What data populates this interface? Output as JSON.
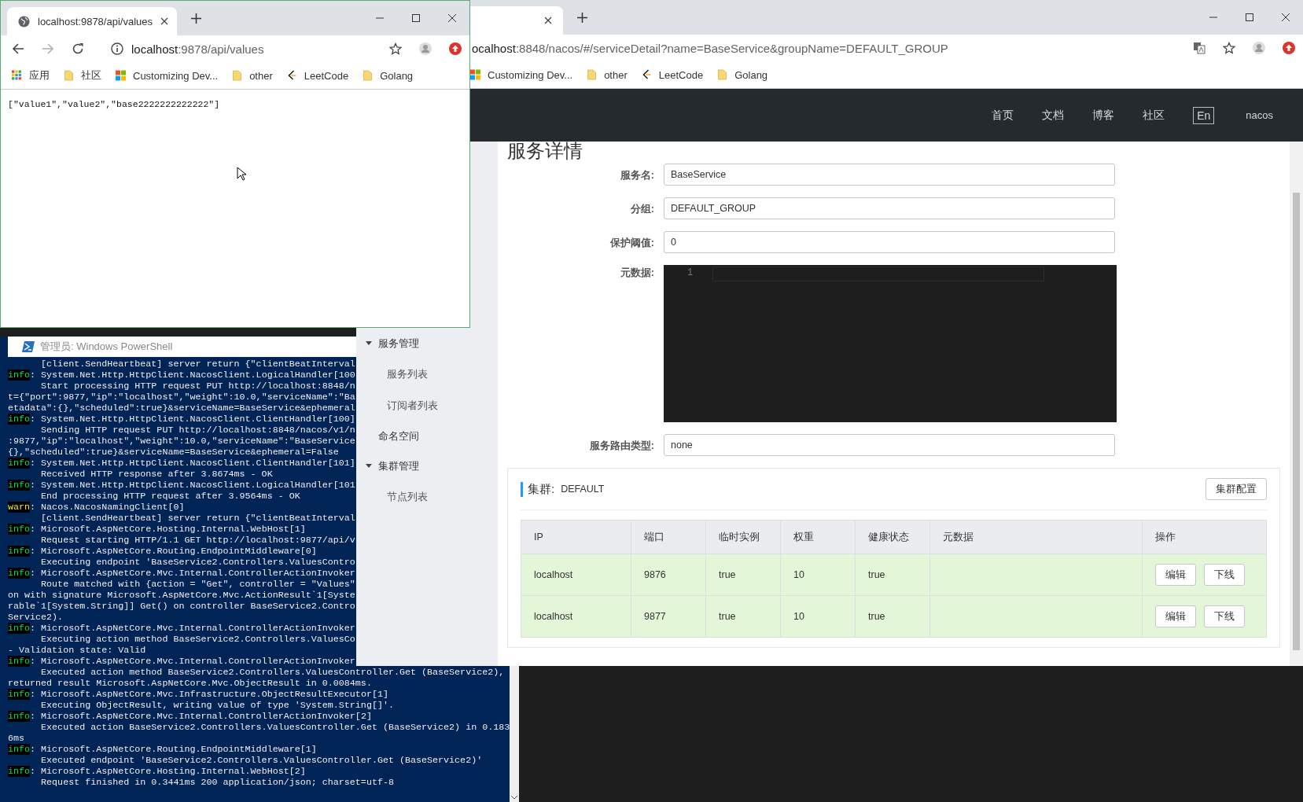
{
  "browser_front": {
    "tab_title": "localhost:9878/api/values",
    "address_host": "localhost",
    "address_path": ":9878/api/values",
    "forward_disabled": true,
    "bookmarks": [
      {
        "kind": "apps",
        "label": "应用"
      },
      {
        "kind": "folder",
        "label": "社区"
      },
      {
        "kind": "windows",
        "label": "Customizing Dev..."
      },
      {
        "kind": "folder",
        "label": "other"
      },
      {
        "kind": "leetcode",
        "label": "LeetCode"
      },
      {
        "kind": "folder",
        "label": "Golang"
      }
    ],
    "content": "[\"value1\",\"value2\",\"base2222222222222\"]"
  },
  "powershell": {
    "title": "管理员: Windows PowerShell",
    "lines": [
      {
        "kind": "cont",
        "text": "[client.SendHeartbeat] server return {\"clientBeatInterval"
      },
      {
        "kind": "info",
        "tag": "info",
        "text": ": System.Net.Http.HttpClient.NacosClient.LogicalHandler[100"
      },
      {
        "kind": "cont",
        "text": "Start processing HTTP request PUT http://localhost:8848/n"
      },
      {
        "kind": "wrap",
        "text": "t={\"port\":9877,\"ip\":\"localhost\",\"weight\":10.0,\"serviceName\":\"Ba"
      },
      {
        "kind": "wrap",
        "text": "etadata\":{},\"scheduled\":true}&serviceName=BaseService&ephemeral"
      },
      {
        "kind": "info",
        "tag": "info",
        "text": ": System.Net.Http.HttpClient.NacosClient.ClientHandler[100]"
      },
      {
        "kind": "cont",
        "text": "Sending HTTP request PUT http://localhost:8848/nacos/v1/n"
      },
      {
        "kind": "wrap",
        "text": ":9877,\"ip\":\"localhost\",\"weight\":10.0,\"serviceName\":\"BaseService"
      },
      {
        "kind": "wrap",
        "text": "{},\"scheduled\":true}&serviceName=BaseService&ephemeral=False"
      },
      {
        "kind": "info",
        "tag": "info",
        "text": ": System.Net.Http.HttpClient.NacosClient.ClientHandler[101]"
      },
      {
        "kind": "cont",
        "text": "Received HTTP response after 3.8674ms - OK"
      },
      {
        "kind": "info",
        "tag": "info",
        "text": ": System.Net.Http.HttpClient.NacosClient.LogicalHandler[101"
      },
      {
        "kind": "cont",
        "text": "End processing HTTP request after 3.9564ms - OK"
      },
      {
        "kind": "warn",
        "tag": "warn",
        "text": ": Nacos.NacosNamingClient[0]"
      },
      {
        "kind": "cont",
        "text": "[client.SendHeartbeat] server return {\"clientBeatInterval"
      },
      {
        "kind": "info",
        "tag": "info",
        "text": ": Microsoft.AspNetCore.Hosting.Internal.WebHost[1]"
      },
      {
        "kind": "cont",
        "text": "Request starting HTTP/1.1 GET http://localhost:9877/api/v"
      },
      {
        "kind": "info",
        "tag": "info",
        "text": ": Microsoft.AspNetCore.Routing.EndpointMiddleware[0]"
      },
      {
        "kind": "cont",
        "text": "Executing endpoint 'BaseService2.Controllers.ValuesContro"
      },
      {
        "kind": "info",
        "tag": "info",
        "text": ": Microsoft.AspNetCore.Mvc.Internal.ControllerActionInvoker"
      },
      {
        "kind": "cont",
        "text": "Route matched with {action = \"Get\", controller = \"Values\""
      },
      {
        "kind": "wrap",
        "text": "on with signature Microsoft.AspNetCore.Mvc.ActionResult`1[Syste"
      },
      {
        "kind": "wrap",
        "text": "rable`1[System.String]] Get() on controller BaseService2.Contro"
      },
      {
        "kind": "wrap",
        "text": "Service2)."
      },
      {
        "kind": "info",
        "tag": "info",
        "text": ": Microsoft.AspNetCore.Mvc.Internal.ControllerActionInvoker"
      },
      {
        "kind": "cont",
        "text": "Executing action method BaseService2.Controllers.ValuesCo"
      },
      {
        "kind": "wrap",
        "text": "- Validation state: Valid"
      },
      {
        "kind": "info",
        "tag": "info",
        "text": ": Microsoft.AspNetCore.Mvc.Internal.ControllerActionInvoker"
      },
      {
        "kind": "cont",
        "text": "Executed action method BaseService2.Controllers.ValuesController.Get (BaseService2),"
      },
      {
        "kind": "wrap",
        "text": "returned result Microsoft.AspNetCore.Mvc.ObjectResult in 0.0084ms."
      },
      {
        "kind": "info",
        "tag": "info",
        "text": ": Microsoft.AspNetCore.Mvc.Infrastructure.ObjectResultExecutor[1]"
      },
      {
        "kind": "cont",
        "text": "Executing ObjectResult, writing value of type 'System.String[]'."
      },
      {
        "kind": "info",
        "tag": "info",
        "text": ": Microsoft.AspNetCore.Mvc.Internal.ControllerActionInvoker[2]"
      },
      {
        "kind": "cont",
        "text": "Executed action BaseService2.Controllers.ValuesController.Get (BaseService2) in 0.183"
      },
      {
        "kind": "wrap",
        "text": "6ms"
      },
      {
        "kind": "info",
        "tag": "info",
        "text": ": Microsoft.AspNetCore.Routing.EndpointMiddleware[1]"
      },
      {
        "kind": "cont",
        "text": "Executed endpoint 'BaseService2.Controllers.ValuesController.Get (BaseService2)'"
      },
      {
        "kind": "info",
        "tag": "info",
        "text": ": Microsoft.AspNetCore.Hosting.Internal.WebHost[2]"
      },
      {
        "kind": "cont",
        "text": "Request finished in 0.3441ms 200 application/json; charset=utf-8"
      }
    ]
  },
  "browser_back": {
    "address_host": "ocalhost",
    "address_path": ":8848/nacos/#/serviceDetail?name=BaseService&groupName=DEFAULT_GROUP",
    "bookmarks": [
      {
        "kind": "windows",
        "label": "Customizing Dev..."
      },
      {
        "kind": "folder",
        "label": "other"
      },
      {
        "kind": "leetcode",
        "label": "LeetCode"
      },
      {
        "kind": "folder",
        "label": "Golang"
      }
    ],
    "nav": [
      "首页",
      "文档",
      "博客",
      "社区"
    ],
    "lang": "En",
    "user": "nacos",
    "sidebar": [
      {
        "label": "服务管理",
        "expanded": true,
        "children": [
          {
            "label": "服务列表"
          },
          {
            "label": "订阅者列表"
          }
        ]
      },
      {
        "label": "命名空间"
      },
      {
        "label": "集群管理",
        "expanded": true,
        "children": [
          {
            "label": "节点列表"
          }
        ]
      }
    ],
    "page_title": "服务详情",
    "form": [
      {
        "kind": "input",
        "label": "服务名:",
        "value": "BaseService"
      },
      {
        "kind": "input",
        "label": "分组:",
        "value": "DEFAULT_GROUP"
      },
      {
        "kind": "input",
        "label": "保护阈值:",
        "value": "0"
      },
      {
        "kind": "editor",
        "label": "元数据:",
        "line": "1"
      },
      {
        "kind": "input",
        "label": "服务路由类型:",
        "value": "none"
      }
    ],
    "cluster": {
      "label": "集群:",
      "name": "DEFAULT",
      "config_button": "集群配置",
      "columns": [
        "IP",
        "端口",
        "临时实例",
        "权重",
        "健康状态",
        "元数据",
        "操作"
      ],
      "rows": [
        {
          "cells": [
            "localhost",
            "9876",
            "true",
            "10",
            "true",
            ""
          ],
          "actions": [
            "编辑",
            "下线"
          ]
        },
        {
          "cells": [
            "localhost",
            "9877",
            "true",
            "10",
            "true",
            ""
          ],
          "actions": [
            "编辑",
            "下线"
          ]
        }
      ]
    }
  }
}
